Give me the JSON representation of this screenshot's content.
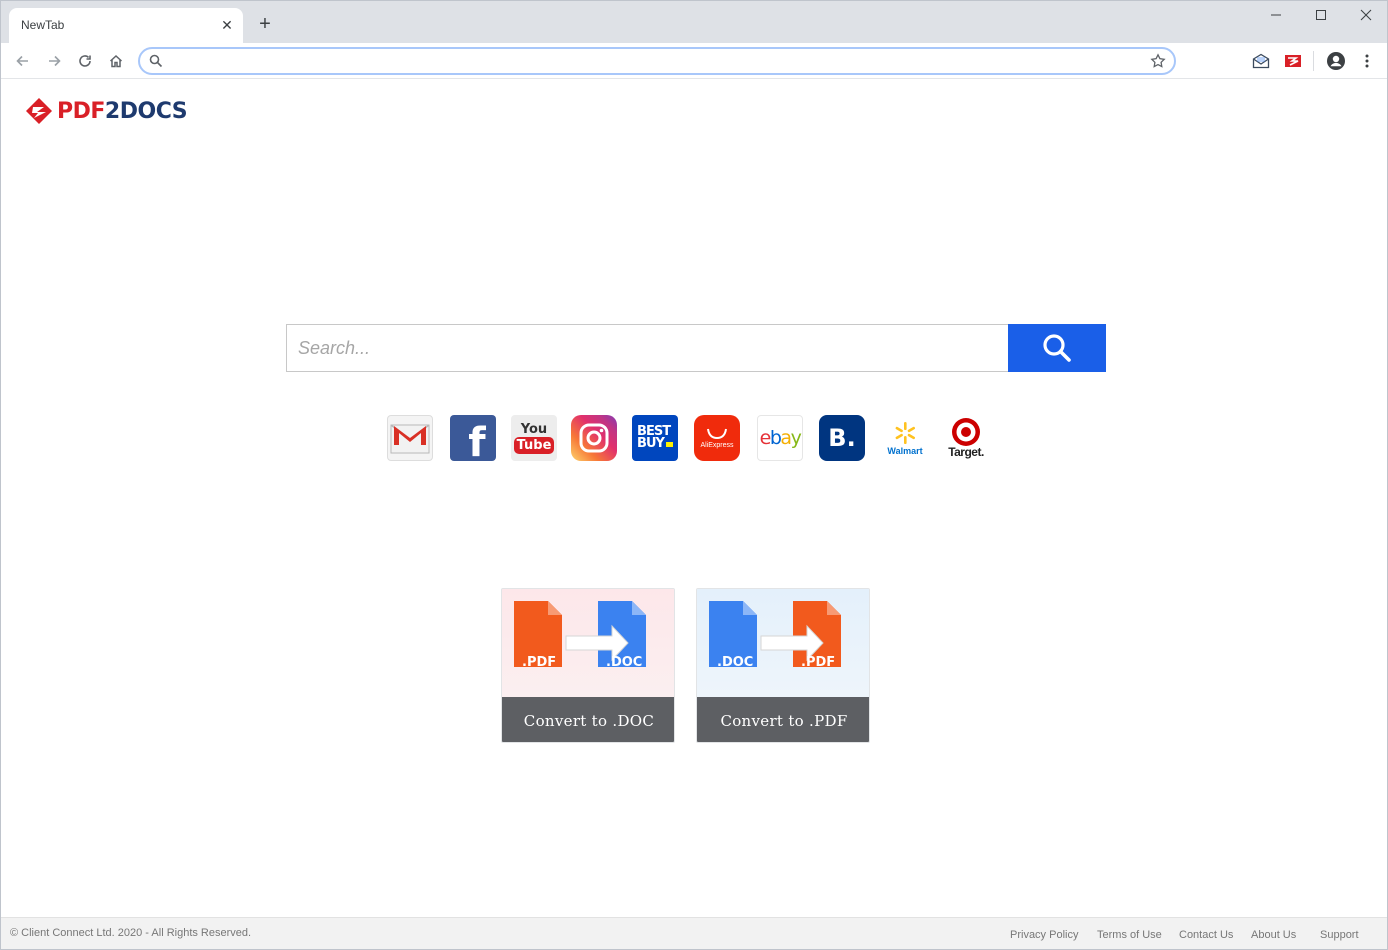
{
  "browser": {
    "tab_title": "NewTab",
    "tab_close": "✕",
    "new_tab": "+",
    "address_value": ""
  },
  "page": {
    "logo": {
      "part1": "PDF",
      "part2": "2DOCS"
    },
    "search": {
      "placeholder": "Search..."
    },
    "shortcuts": [
      {
        "name": "Gmail",
        "icon": "gmail-icon"
      },
      {
        "name": "Facebook",
        "icon": "facebook-icon",
        "glyph": "f"
      },
      {
        "name": "YouTube",
        "icon": "youtube-icon",
        "line1": "You",
        "line2": "Tube"
      },
      {
        "name": "Instagram",
        "icon": "instagram-icon"
      },
      {
        "name": "Best Buy",
        "icon": "bestbuy-icon",
        "line1": "BEST",
        "line2": "BUY"
      },
      {
        "name": "AliExpress",
        "icon": "aliexpress-icon",
        "label": "AliExpress"
      },
      {
        "name": "eBay",
        "icon": "ebay-icon",
        "letters": [
          "e",
          "b",
          "a",
          "y"
        ]
      },
      {
        "name": "Booking",
        "icon": "booking-icon",
        "glyph": "B."
      },
      {
        "name": "Walmart",
        "icon": "walmart-icon",
        "label": "Walmart"
      },
      {
        "name": "Target",
        "icon": "target-icon",
        "label": "Target."
      }
    ],
    "convert": [
      {
        "label": "Convert to .DOC",
        "from": ".PDF",
        "to": ".DOC"
      },
      {
        "label": "Convert to .PDF",
        "from": ".DOC",
        "to": ".PDF"
      }
    ]
  },
  "footer": {
    "copyright": "© Client Connect Ltd. 2020 - All Rights Reserved.",
    "links": [
      "Privacy Policy",
      "Terms of Use",
      "Contact Us",
      "About Us",
      "Support"
    ]
  },
  "colors": {
    "search_button": "#1a5fe8",
    "pdf_orange": "#f25a1d",
    "doc_blue": "#3b82f0",
    "card_label_bg": "#5d5f63",
    "logo_red": "#d92027",
    "logo_navy": "#1e3a6e"
  }
}
